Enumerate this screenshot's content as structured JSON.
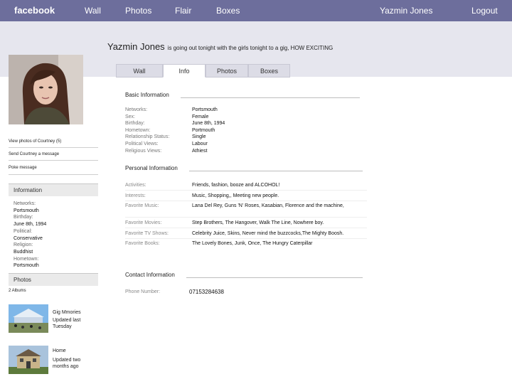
{
  "nav": {
    "logo": "facebook",
    "wall": "Wall",
    "photos": "Photos",
    "flair": "Flair",
    "boxes": "Boxes",
    "user": "Yazmin Jones",
    "logout": "Logout"
  },
  "profile": {
    "name": "Yazmin Jones",
    "status": "is going out tonight with the girls tonight to a gig, HOW EXCITING"
  },
  "tabs": [
    "Wall",
    "Info",
    "Photos",
    "Boxes"
  ],
  "active_tab": "Info",
  "sidebar": {
    "view_photos": "View photos of Courtney (5)",
    "send_message": "Send Courtney a message",
    "poke": "Poke message",
    "information_title": "Information",
    "information": [
      {
        "label": "Networks:",
        "value": "Portsmouth"
      },
      {
        "label": "Birthday:",
        "value": "June 8th, 1994"
      },
      {
        "label": "Political:",
        "value": "Conservative"
      },
      {
        "label": "Religion:",
        "value": "Buddhist"
      },
      {
        "label": "Hometown:",
        "value": "Portsmouth"
      }
    ],
    "photos_title": "Photos",
    "albums_count": "2 Albums",
    "albums": [
      {
        "title": "Gig Mmories",
        "updated": "Updated last Tuesday"
      },
      {
        "title": "Home",
        "updated": "Updated two months ago"
      }
    ]
  },
  "basic": {
    "title": "Basic Information",
    "rows": [
      {
        "label": "Networks:",
        "value": "Portsmouth"
      },
      {
        "label": "Sex:",
        "value": "Female"
      },
      {
        "label": "Birthday:",
        "value": "June 8th, 1994"
      },
      {
        "label": "Hometown:",
        "value": "Portmouth"
      },
      {
        "label": "Relationship Status:",
        "value": "Single"
      },
      {
        "label": "Political Views:",
        "value": "Labour"
      },
      {
        "label": "Religious Views:",
        "value": "Athiest"
      }
    ]
  },
  "personal": {
    "title": "Personal Information",
    "rows": [
      {
        "label": "Activities:",
        "value": "Friends, fashion, booze and ALCOHOL!"
      },
      {
        "label": "Interests:",
        "value": "Music, Shopping,, Meeting new people."
      },
      {
        "label": "Favorite Music:",
        "value": "Lana Del Rey, Guns 'N' Roses,  Kasabian, Florence and the machine,"
      },
      {
        "label": "Favorite Movies:",
        "value": "Step Brothers, The Hangover, Walk The Line, Nowhere boy."
      },
      {
        "label": "Favorite TV Shows:",
        "value": "Celebrity Juice, Skins, Never mind the buzzcocks,The Mighty Boosh."
      },
      {
        "label": "Favorite Books:",
        "value": "The Lovely Bones, Junk, Once, The Hungry Caterpillar"
      }
    ]
  },
  "contact": {
    "title": "Contact Information",
    "phone_label": "Phone Number:",
    "phone": "07153284638"
  }
}
